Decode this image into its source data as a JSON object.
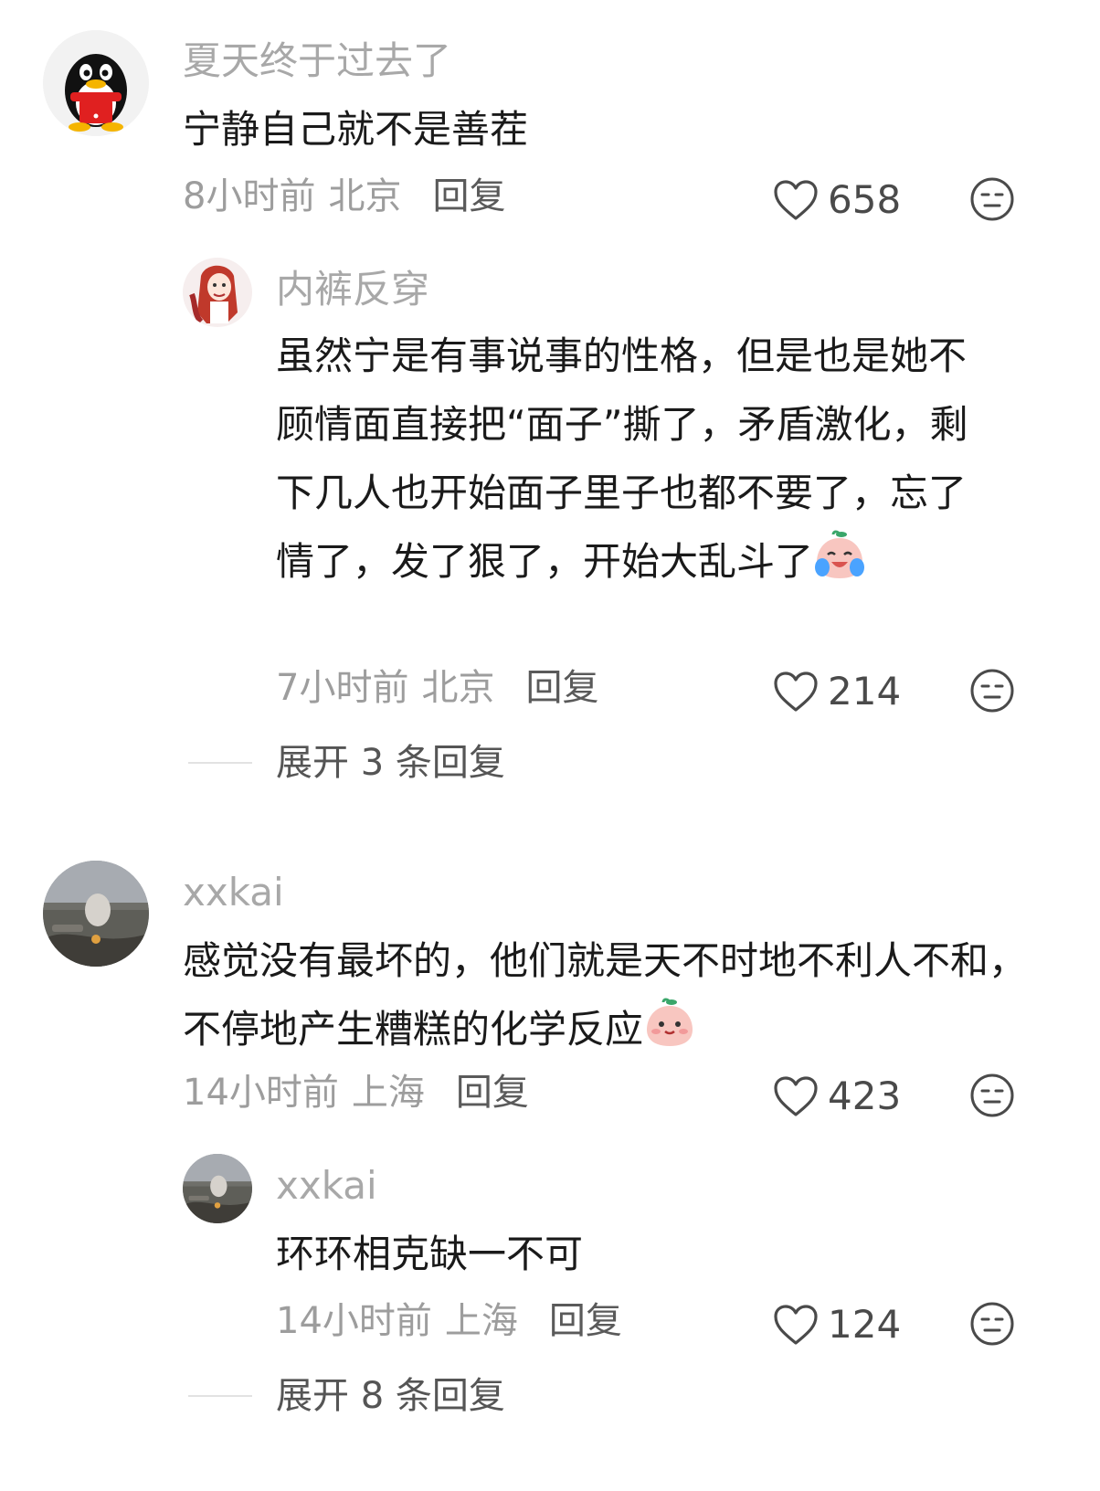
{
  "comments": [
    {
      "username": "夏天终于过去了",
      "avatar_icon": "qq-penguin-avatar",
      "text": "宁静自己就不是善茬",
      "time": "8小时前",
      "location": "北京",
      "reply_label": "回复",
      "likes": "658",
      "replies": [
        {
          "username": "内裤反穿",
          "avatar_icon": "anime-girl-avatar",
          "text": "虽然宁是有事说事的性格，但是也是她不顾情面直接把“面子”撕了，矛盾激化，剩下几人也开始面子里子也都不要了，忘了情了，发了狠了，开始大乱斗了",
          "emoji": "crying-laughing-peach-emoji",
          "time": "7小时前",
          "location": "北京",
          "reply_label": "回复",
          "likes": "214"
        }
      ],
      "expand_label": "展开 3 条回复"
    },
    {
      "username": "xxkai",
      "avatar_icon": "landscape-photo-avatar",
      "text": "感觉没有最坏的，他们就是天不时地不利人不和，不停地产生糟糕的化学反应",
      "emoji": "blushing-peach-emoji",
      "time": "14小时前",
      "location": "上海",
      "reply_label": "回复",
      "likes": "423",
      "replies": [
        {
          "username": "xxkai",
          "avatar_icon": "landscape-photo-avatar",
          "text": "环环相克缺一不可",
          "time": "14小时前",
          "location": "上海",
          "reply_label": "回复",
          "likes": "124"
        }
      ],
      "expand_label": "展开 8 条回复"
    }
  ],
  "colors": {
    "username": "#a8a8a8",
    "text": "#1a1a1a",
    "meta": "#9d9d9d",
    "reply": "#5a5a5a"
  }
}
